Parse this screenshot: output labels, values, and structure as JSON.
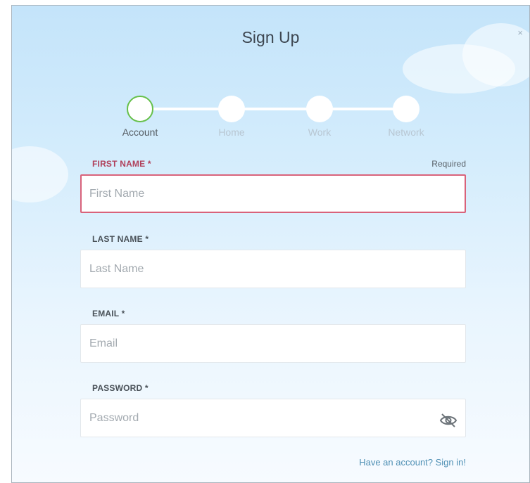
{
  "dialog": {
    "title": "Sign Up",
    "close_label": "×"
  },
  "stepper": {
    "steps": [
      {
        "label": "Account",
        "active": true
      },
      {
        "label": "Home",
        "active": false
      },
      {
        "label": "Work",
        "active": false
      },
      {
        "label": "Network",
        "active": false
      }
    ]
  },
  "form": {
    "required_note": "Required",
    "first_name": {
      "label": "FIRST NAME *",
      "placeholder": "First Name",
      "value": ""
    },
    "last_name": {
      "label": "LAST NAME *",
      "placeholder": "Last Name",
      "value": ""
    },
    "email": {
      "label": "EMAIL *",
      "placeholder": "Email",
      "value": ""
    },
    "password": {
      "label": "PASSWORD *",
      "placeholder": "Password",
      "value": "",
      "toggle_icon": "eye-slash-icon"
    }
  },
  "footer": {
    "signin_link": "Have an account? Sign in!"
  },
  "colors": {
    "active_step": "#66c04a",
    "error": "#d9627a",
    "link": "#4e8fb4",
    "background_top": "#c4e4fa"
  }
}
